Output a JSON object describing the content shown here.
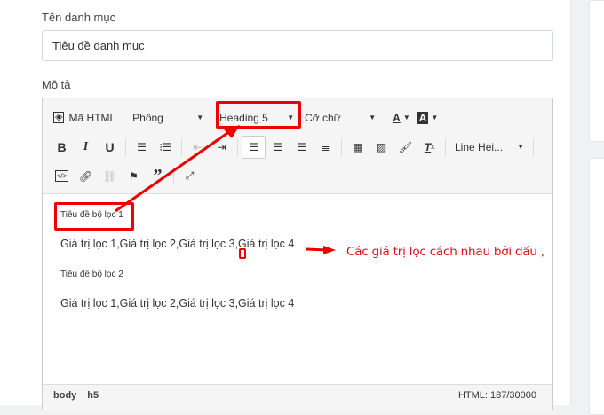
{
  "form": {
    "category_label": "Tên danh mục",
    "category_value": "Tiêu đề danh mục",
    "description_label": "Mô tả"
  },
  "toolbar": {
    "html_label": "Mã HTML",
    "font_label": "Phông",
    "heading_label": "Heading 5",
    "size_label": "Cỡ chữ",
    "line_height_label": "Line Hei...",
    "bold": "B",
    "italic": "I",
    "underline": "U"
  },
  "content": {
    "heading1": "Tiêu đề bộ lọc 1",
    "values1": "Giá trị lọc 1,Giá trị lọc 2,Giá trị lọc 3,Giá trị lọc 4",
    "heading2": "Tiêu đề bộ lọc 2",
    "values2": "Giá trị lọc 1,Giá trị lọc 2,Giá trị lọc 3,Giá trị lọc 4"
  },
  "status": {
    "path1": "body",
    "path2": "h5",
    "count": "HTML: 187/30000"
  },
  "annotation": {
    "note": "Các giá trị lọc cách nhau bởi dấu ,",
    "color": "#e00000"
  }
}
